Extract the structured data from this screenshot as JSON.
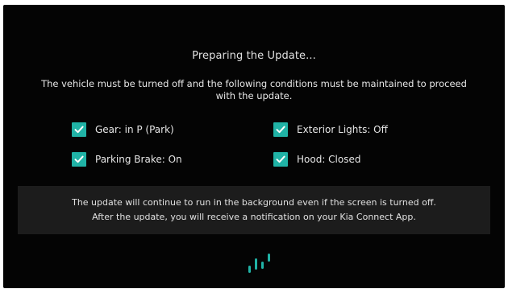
{
  "update": {
    "title": "Preparing the Update...",
    "intro_line1": "The vehicle must be turned off and the following conditions must be maintained to proceed",
    "intro_line2": "with the update.",
    "conditions": [
      {
        "label": "Gear: in P (Park)",
        "checked": true
      },
      {
        "label": "Exterior Lights: Off",
        "checked": true
      },
      {
        "label": "Parking Brake: On",
        "checked": true
      },
      {
        "label": "Hood: Closed",
        "checked": true
      }
    ],
    "notice_line1": "The update will continue to run in the background even if the screen is turned off.",
    "notice_line2": "After the update, you will receive a notification on your Kia Connect App.",
    "loading_icon": "loading-spinner-icon"
  },
  "colors": {
    "background": "#040404",
    "accent": "#20b3a6",
    "text": "#e6e6e6",
    "notice_background": "#1c1c1c"
  }
}
